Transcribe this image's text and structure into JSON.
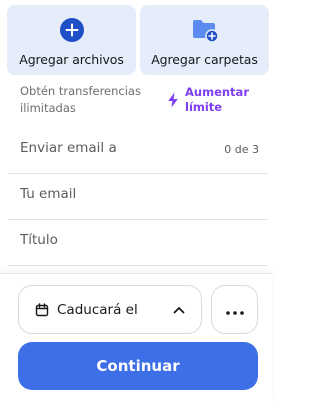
{
  "upload": {
    "add_files_label": "Agregar archivos",
    "add_folders_label": "Agregar carpetas"
  },
  "transfers": {
    "info_text": "Obtén transferencias ilimitadas",
    "boost_label": "Aumentar límite"
  },
  "form": {
    "email_to_placeholder": "Enviar email a",
    "recipient_count": "0 de 3",
    "your_email_placeholder": "Tu email",
    "title_placeholder": "Título"
  },
  "footer": {
    "expiry_label": "Caducará el",
    "continue_label": "Continuar"
  },
  "colors": {
    "accent": "#3d6fe8",
    "accent_dark": "#1f4fc7",
    "upload_bg": "#e5ecfa",
    "boost": "#7e3ff2"
  },
  "icons": {
    "add_files": "plus-circle-icon",
    "add_folders": "folder-plus-icon",
    "boost": "lightning-icon",
    "expiry": "calendar-icon",
    "expiry_toggle": "chevron-up-icon",
    "more": "more-horizontal-icon"
  }
}
